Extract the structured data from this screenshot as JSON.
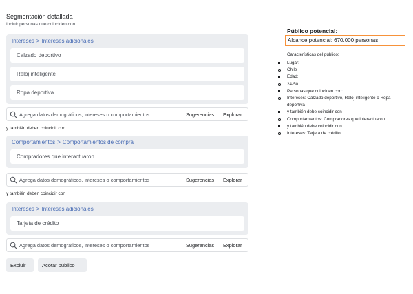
{
  "header": {
    "title": "Segmentación detallada",
    "subtitle": "Incluir personas que coinciden con"
  },
  "groups": [
    {
      "breadcrumb": [
        "Intereses",
        "Intereses adicionales"
      ],
      "items": [
        "Calzado deportivo",
        "Reloj inteligente",
        "Ropa deportiva"
      ]
    },
    {
      "breadcrumb": [
        "Comportamientos",
        "Comportamientos de compra"
      ],
      "items": [
        "Compradores que interactuaron"
      ]
    },
    {
      "breadcrumb": [
        "Intereses",
        "Intereses adicionales"
      ],
      "items": [
        "Tarjeta de crédito"
      ]
    }
  ],
  "breadcrumb_separator": ">",
  "search": {
    "placeholder": "Agrega datos demográficos, intereses o comportamientos",
    "suggestions_label": "Sugerencias",
    "explore_label": "Explorar",
    "icon": "search-icon"
  },
  "and_also_label": "y también deben coincidir con",
  "buttons": {
    "exclude": "Excluir",
    "narrow": "Acotar público"
  },
  "audience": {
    "title": "Público potencial:",
    "reach": "Alcance potencial: 670.000 personas",
    "characteristics_title": "Características del público:",
    "characteristics": [
      {
        "bullet": "filled",
        "text": "Lugar:"
      },
      {
        "bullet": "hollow",
        "text": "Chile"
      },
      {
        "bullet": "filled",
        "text": "Edad:"
      },
      {
        "bullet": "hollow",
        "text": "24-50"
      },
      {
        "bullet": "filled",
        "text": "Personas que coinciden con:"
      },
      {
        "bullet": "hollow",
        "text": "Intereses: Calzado deportivo, Reloj inteligente o Ropa deportiva"
      },
      {
        "bullet": "filled",
        "text": "y también debe coincidir con"
      },
      {
        "bullet": "hollow",
        "text": "Comportamientos: Compradores que interactuaron"
      },
      {
        "bullet": "filled",
        "text": "y también debe coincidir con"
      },
      {
        "bullet": "hollow",
        "text": "Intereses: Tarjeta de crédito"
      }
    ]
  },
  "colors": {
    "link": "#4267b2",
    "highlight_border": "#f7923a",
    "panel_bg": "#ebedf0"
  }
}
